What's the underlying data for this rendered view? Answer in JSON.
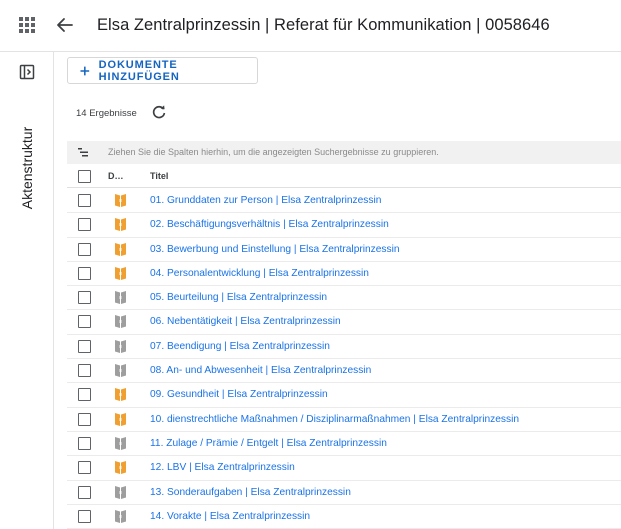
{
  "header": {
    "title": "Elsa Zentralprinzessin | Referat für Kommunikation | 0058646",
    "apps_icon": "apps-grid-icon",
    "back_icon": "arrow-back-icon"
  },
  "rail": {
    "toggle_icon": "panel-toggle-icon",
    "label": "Aktenstruktur"
  },
  "toolbar": {
    "add_label": "DOKUMENTE HINZUFÜGEN",
    "add_icon": "plus-icon"
  },
  "results": {
    "count_label": "14 Ergebnisse",
    "refresh_icon": "refresh-icon"
  },
  "grouping": {
    "text": "Ziehen Sie die Spalten hierhin, um die angezeigten Suchergebnisse zu gruppieren."
  },
  "columns": {
    "d": "D…",
    "title": "Titel"
  },
  "colors": {
    "link": "#1a73e8",
    "folder_orange": "#f0a030",
    "folder_gray": "#9e9e9e",
    "accent": "#1565c0"
  },
  "rows": [
    {
      "title": "01. Grunddaten zur Person | Elsa Zentralprinzessin",
      "icon": "folder-orange"
    },
    {
      "title": "02. Beschäftigungsverhältnis | Elsa Zentralprinzessin",
      "icon": "folder-orange"
    },
    {
      "title": "03. Bewerbung und Einstellung | Elsa Zentralprinzessin",
      "icon": "folder-orange"
    },
    {
      "title": "04. Personalentwicklung | Elsa Zentralprinzessin",
      "icon": "folder-orange"
    },
    {
      "title": "05. Beurteilung | Elsa Zentralprinzessin",
      "icon": "folder-gray"
    },
    {
      "title": "06. Nebentätigkeit | Elsa Zentralprinzessin",
      "icon": "folder-gray"
    },
    {
      "title": "07. Beendigung | Elsa Zentralprinzessin",
      "icon": "folder-gray"
    },
    {
      "title": "08. An- und Abwesenheit | Elsa Zentralprinzessin",
      "icon": "folder-gray"
    },
    {
      "title": "09. Gesundheit | Elsa Zentralprinzessin",
      "icon": "folder-orange"
    },
    {
      "title": "10. dienstrechtliche Maßnahmen / Disziplinarmaßnahmen | Elsa Zentralprinzessin",
      "icon": "folder-orange"
    },
    {
      "title": "11. Zulage / Prämie / Entgelt | Elsa Zentralprinzessin",
      "icon": "folder-gray"
    },
    {
      "title": "12. LBV | Elsa Zentralprinzessin",
      "icon": "folder-orange"
    },
    {
      "title": "13. Sonderaufgaben | Elsa Zentralprinzessin",
      "icon": "folder-gray"
    },
    {
      "title": "14. Vorakte | Elsa Zentralprinzessin",
      "icon": "folder-gray"
    }
  ]
}
